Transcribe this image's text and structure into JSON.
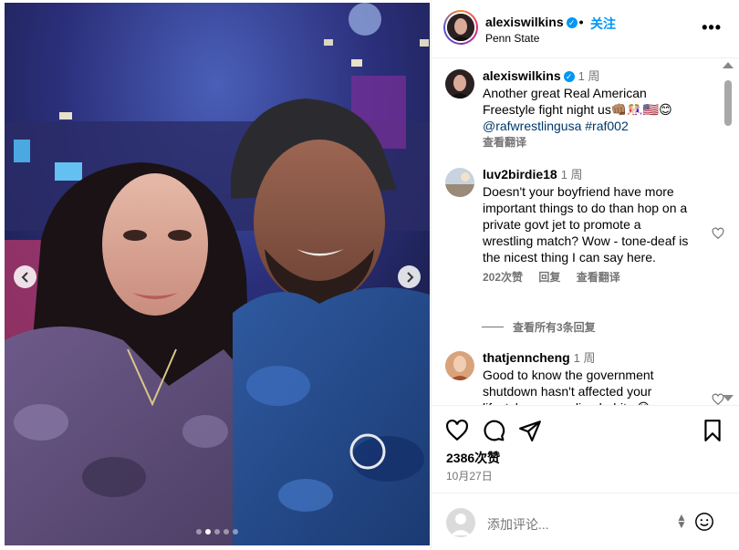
{
  "post": {
    "username": "alexiswilkins",
    "verified": true,
    "separator": "•",
    "follow_label": "关注",
    "location": "Penn State",
    "more_label": "•••"
  },
  "caption": {
    "username": "alexiswilkins",
    "time": "1 周",
    "text": "Another great Real American Freestyle fight night us👊🏽🤼🏼‍♀️🇺🇸😊",
    "tags": "@rafwrestlingusa #raf002",
    "translate": "查看翻译"
  },
  "comments": [
    {
      "username": "luv2birdie18",
      "time": "1 周",
      "text": "Doesn't your boyfriend have more important things to do than hop on a private govt jet to promote a wrestling match? Wow - tone-deaf is the nicest thing I can say here.",
      "likes": "202次赞",
      "reply": "回复",
      "translate": "查看翻译",
      "view_replies": "查看所有3条回复"
    },
    {
      "username": "thatjenncheng",
      "time": "1 周",
      "text": "Good to know the government shutdown hasn't affected your lifestyle or spending habits 😊"
    }
  ],
  "likes_count": "2386次赞",
  "date": "10月27日",
  "add_comment_placeholder": "添加评论...",
  "carousel": {
    "total": 5,
    "active": 1
  },
  "colors": {
    "accent": "#0095f6",
    "link": "#00376b",
    "muted": "#737373"
  },
  "icons": [
    "heart-icon",
    "comment-icon",
    "share-icon",
    "bookmark-icon",
    "emoji-icon",
    "more-icon",
    "verified-badge-icon"
  ]
}
